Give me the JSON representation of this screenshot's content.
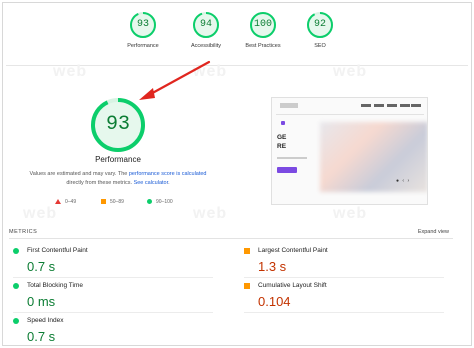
{
  "scores": [
    {
      "value": "93",
      "label": "Performance",
      "fraction": 0.93
    },
    {
      "value": "94",
      "label": "Accessibility",
      "fraction": 0.94
    },
    {
      "value": "100",
      "label": "Best Practices",
      "fraction": 1.0
    },
    {
      "value": "92",
      "label": "SEO",
      "fraction": 0.92
    }
  ],
  "main": {
    "score": "93",
    "fraction": 0.93,
    "title": "Performance",
    "note_prefix": "Values are estimated and may vary. The ",
    "note_link1": "performance score is calculated",
    "note_mid": " directly from these metrics. ",
    "note_link2": "See calculator",
    "note_suffix": "."
  },
  "legend": {
    "poor": "0–49",
    "average": "50–89",
    "good": "90–100"
  },
  "metrics_section": {
    "header": "METRICS",
    "expand": "Expand view"
  },
  "metrics": [
    {
      "name": "First Contentful Paint",
      "value": "0.7 s",
      "status": "good"
    },
    {
      "name": "Largest Contentful Paint",
      "value": "1.3 s",
      "status": "average"
    },
    {
      "name": "Total Blocking Time",
      "value": "0 ms",
      "status": "good"
    },
    {
      "name": "Cumulative Layout Shift",
      "value": "0.104",
      "status": "average"
    },
    {
      "name": "Speed Index",
      "value": "0.7 s",
      "status": "good"
    }
  ],
  "preview": {
    "heading1": "GE",
    "heading2": "RE",
    "controls": "● ‹ ›"
  },
  "colors": {
    "good": "#0cce6b",
    "good_text": "#0c7d34",
    "average": "#ff9800",
    "average_text": "#c33300",
    "poor": "#e53935",
    "link": "#1a5bd6",
    "arrow": "#e0261f"
  },
  "watermark": "web"
}
